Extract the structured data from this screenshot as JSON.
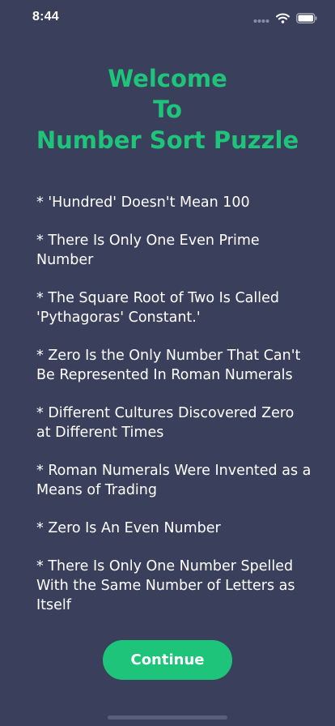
{
  "status_bar": {
    "time": "8:44",
    "icons": [
      "signal-dots-icon",
      "wifi-icon",
      "battery-icon"
    ]
  },
  "title": {
    "line1": "Welcome",
    "line2": "To",
    "line3": "Number Sort Puzzle"
  },
  "facts": [
    "* 'Hundred' Doesn't Mean 100",
    "* There Is Only One Even Prime Number",
    "* The Square Root of Two Is Called 'Pythagoras' Constant.'",
    "* Zero Is the Only Number That Can't Be Represented In Roman Numerals",
    "* Different Cultures Discovered Zero at Different Times",
    "* Roman Numerals Were Invented as a Means of Trading",
    "* Zero Is An Even Number",
    "* There Is Only One Number Spelled With the Same Number of Letters as Itself"
  ],
  "continue_label": "Continue",
  "colors": {
    "background": "#3a3f5c",
    "accent": "#1ec47a",
    "text": "#ffffff"
  }
}
